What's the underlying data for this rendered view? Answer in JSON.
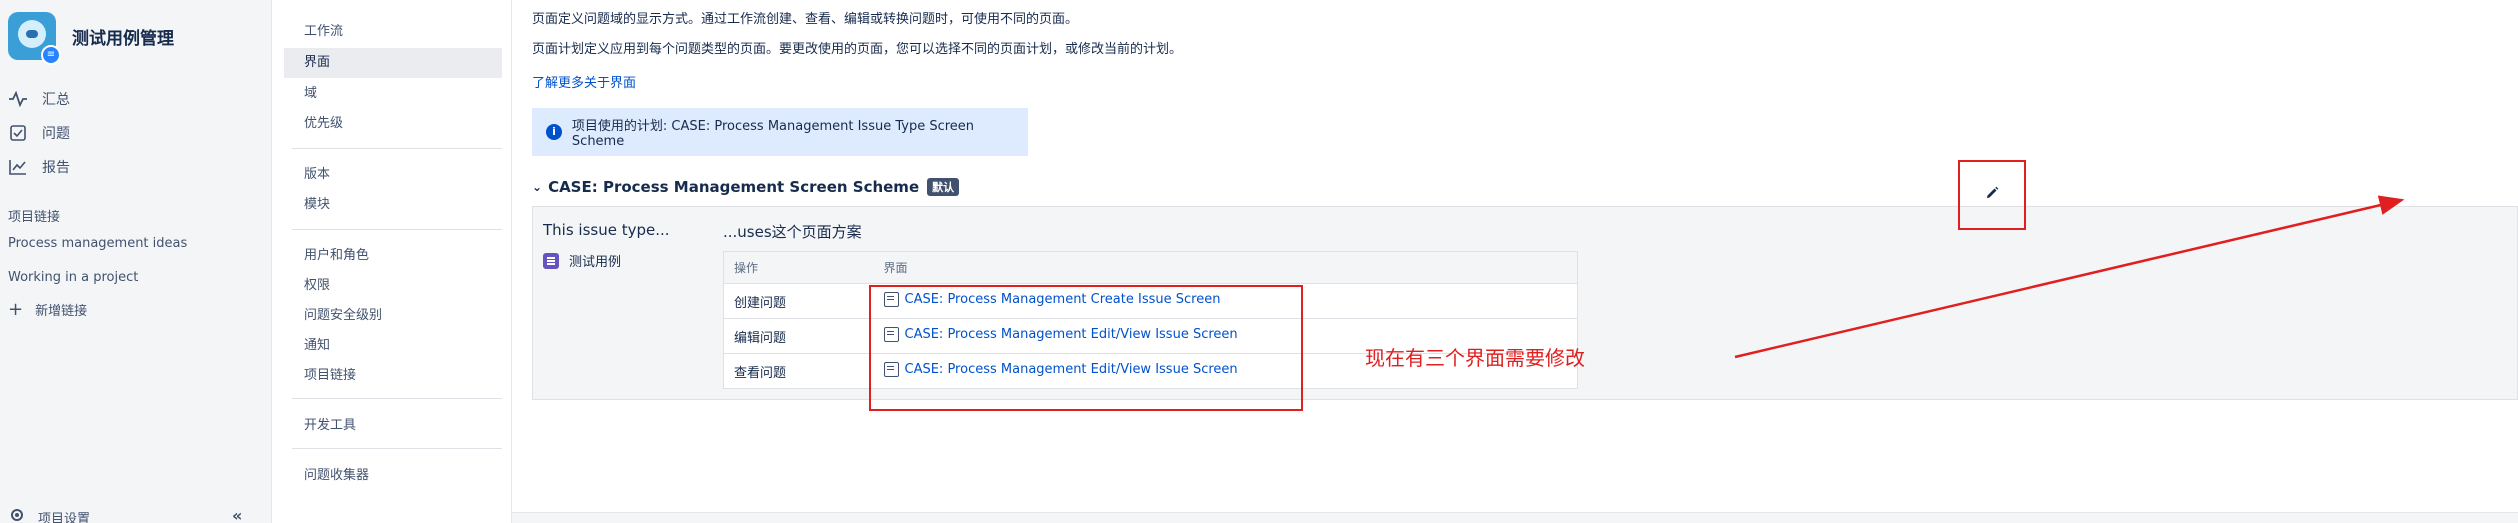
{
  "project": {
    "name": "测试用例管理",
    "avatar_badge": "≡"
  },
  "sidebar": {
    "nav": [
      {
        "icon": "activity-icon",
        "label": "汇总"
      },
      {
        "icon": "issues-icon",
        "label": "问题"
      },
      {
        "icon": "reports-icon",
        "label": "报告"
      }
    ],
    "links_section_title": "项目链接",
    "links": [
      "Process management ideas",
      "Working in a project"
    ],
    "add_link_label": "新增链接",
    "settings_label": "项目设置",
    "collapse_glyph": "«"
  },
  "settings_menu": {
    "group1": [
      "工作流",
      "界面",
      "域",
      "优先级"
    ],
    "group2": [
      "版本",
      "模块"
    ],
    "group3": [
      "用户和角色",
      "权限",
      "问题安全级别",
      "通知",
      "项目链接"
    ],
    "group4": [
      "开发工具"
    ],
    "group5": [
      "问题收集器"
    ],
    "active": "界面"
  },
  "main": {
    "desc1": "页面定义问题域的显示方式。通过工作流创建、查看、编辑或转换问题时，可使用不同的页面。",
    "desc2": "页面计划定义应用到每个问题类型的页面。要更改使用的页面，您可以选择不同的页面计划，或修改当前的计划。",
    "learn_more": "了解更多关于界面",
    "info_banner": "项目使用的计划: CASE: Process Management Issue Type Screen Scheme",
    "scheme_title": "CASE: Process Management Screen Scheme",
    "default_tag": "默认",
    "col_issue_type": "This issue type...",
    "col_uses": "...uses这个页面方案",
    "issue_type_name": "测试用例",
    "table_headers": [
      "操作",
      "界面"
    ],
    "rows": [
      {
        "op": "创建问题",
        "screen": "CASE: Process Management Create Issue Screen"
      },
      {
        "op": "编辑问题",
        "screen": "CASE: Process Management Edit/View Issue Screen"
      },
      {
        "op": "查看问题",
        "screen": "CASE: Process Management Edit/View Issue Screen"
      }
    ],
    "annotation": "现在有三个界面需要修改"
  },
  "colors": {
    "annotation_red": "#e02020",
    "link_blue": "#0052cc",
    "banner_bg": "#deebff"
  }
}
